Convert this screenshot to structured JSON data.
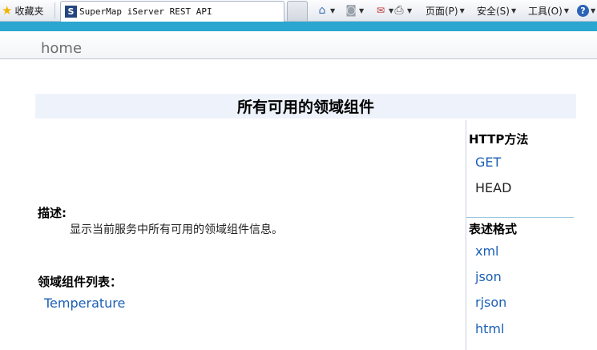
{
  "browser": {
    "favorites_label": "收藏夹",
    "tab_title": "SuperMap iServer REST API",
    "tab_icon_letter": "S",
    "page_menu": "页面(P)",
    "safety_menu": "安全(S)",
    "tools_menu": "工具(O)",
    "help_icon": "?"
  },
  "nav": {
    "home_label": "home"
  },
  "page": {
    "title": "所有可用的领域组件"
  },
  "main": {
    "description_label": "描述:",
    "description_text": "显示当前服务中所有可用的领域组件信息。",
    "list_label": "领域组件列表：",
    "components": [
      "Temperature"
    ]
  },
  "sidebar": {
    "http_methods_title": "HTTP方法",
    "http_methods": [
      "GET",
      "HEAD"
    ],
    "formats_title": "表述格式",
    "formats": [
      "xml",
      "json",
      "rjson",
      "html"
    ]
  },
  "colors": {
    "accent": "#2aa6d1",
    "link": "#1a5fb4",
    "title_band": "#eef3fb"
  }
}
